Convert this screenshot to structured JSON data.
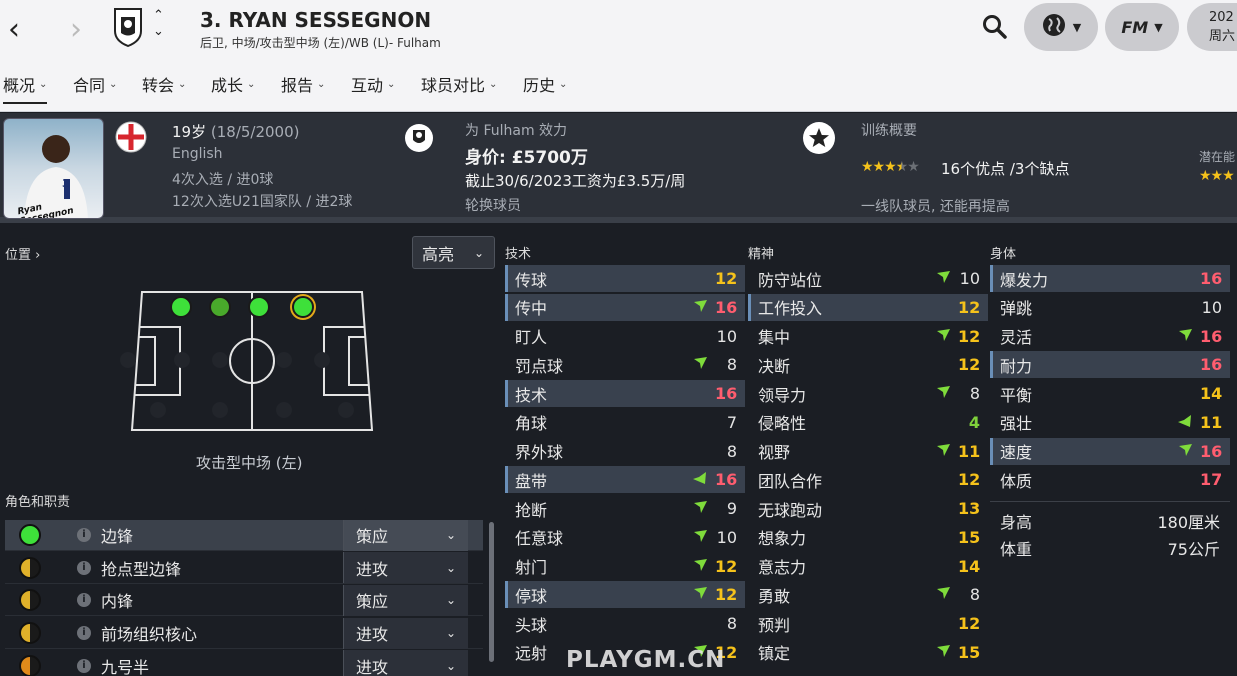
{
  "header": {
    "title": "3. RYAN SESSEGNON",
    "subtitle": "后卫, 中场/攻击型中场 (左)/WB (L)- Fulham",
    "year_fragment": "202",
    "day_fragment": "周六"
  },
  "nav_tabs": [
    "概况",
    "合同",
    "转会",
    "成长",
    "报告",
    "互动",
    "球员对比",
    "历史"
  ],
  "info": {
    "age": "19岁",
    "dob": "(18/5/2000)",
    "nationality": "English",
    "caps": "4次入选 / 进0球",
    "u21_caps": "12次入选U21国家队 / 进2球",
    "plays_for": "为 Fulham 效力",
    "value": "身价: £5700万",
    "wage": "截止30/6/2023工资为£3.5万/周",
    "squad_status": "轮换球员",
    "training_title": "训练概要",
    "training_summary": "16个优点 /3个缺点",
    "training_stars": 3.5,
    "training_note": "一线队球员, 还能再提高",
    "potential_fragment": "潜在能",
    "photo_caption": "Ryan Sessegnon",
    "shirt_number": "3"
  },
  "position": {
    "label": "位置 ›",
    "highlight_select": "高亮",
    "position_name": "攻击型中场 (左)"
  },
  "roles": {
    "title": "角色和职责",
    "items": [
      {
        "name": "边锋",
        "duty": "策应",
        "rating": "green"
      },
      {
        "name": "抢点型边锋",
        "duty": "进攻",
        "rating": "half"
      },
      {
        "name": "内锋",
        "duty": "策应",
        "rating": "half"
      },
      {
        "name": "前场组织核心",
        "duty": "进攻",
        "rating": "half"
      },
      {
        "name": "九号半",
        "duty": "进攻",
        "rating": "half-orange"
      }
    ]
  },
  "technical": {
    "title": "技术",
    "rows": [
      {
        "label": "传球",
        "value": "12",
        "color": "y",
        "arrow": "",
        "hl": true
      },
      {
        "label": "传中",
        "value": "16",
        "color": "r",
        "arrow": "up",
        "hl": true
      },
      {
        "label": "盯人",
        "value": "10",
        "color": "w",
        "arrow": "",
        "hl": false
      },
      {
        "label": "罚点球",
        "value": "8",
        "color": "w",
        "arrow": "up",
        "hl": false
      },
      {
        "label": "技术",
        "value": "16",
        "color": "r",
        "arrow": "",
        "hl": true
      },
      {
        "label": "角球",
        "value": "7",
        "color": "w",
        "arrow": "",
        "hl": false
      },
      {
        "label": "界外球",
        "value": "8",
        "color": "w",
        "arrow": "",
        "hl": false
      },
      {
        "label": "盘带",
        "value": "16",
        "color": "r",
        "arrow": "down",
        "hl": true
      },
      {
        "label": "抢断",
        "value": "9",
        "color": "w",
        "arrow": "up",
        "hl": false
      },
      {
        "label": "任意球",
        "value": "10",
        "color": "w",
        "arrow": "up",
        "hl": false
      },
      {
        "label": "射门",
        "value": "12",
        "color": "y",
        "arrow": "up",
        "hl": false
      },
      {
        "label": "停球",
        "value": "12",
        "color": "y",
        "arrow": "up",
        "hl": true
      },
      {
        "label": "头球",
        "value": "8",
        "color": "w",
        "arrow": "",
        "hl": false
      },
      {
        "label": "远射",
        "value": "12",
        "color": "y",
        "arrow": "up",
        "hl": false
      }
    ]
  },
  "mental": {
    "title": "精神",
    "rows": [
      {
        "label": "防守站位",
        "value": "10",
        "color": "w",
        "arrow": "up",
        "hl": false
      },
      {
        "label": "工作投入",
        "value": "12",
        "color": "y",
        "arrow": "",
        "hl": true
      },
      {
        "label": "集中",
        "value": "12",
        "color": "y",
        "arrow": "up",
        "hl": false
      },
      {
        "label": "决断",
        "value": "12",
        "color": "y",
        "arrow": "",
        "hl": false
      },
      {
        "label": "领导力",
        "value": "8",
        "color": "w",
        "arrow": "up",
        "hl": false
      },
      {
        "label": "侵略性",
        "value": "4",
        "color": "g",
        "arrow": "",
        "hl": false
      },
      {
        "label": "视野",
        "value": "11",
        "color": "y",
        "arrow": "up",
        "hl": false
      },
      {
        "label": "团队合作",
        "value": "12",
        "color": "y",
        "arrow": "",
        "hl": false
      },
      {
        "label": "无球跑动",
        "value": "13",
        "color": "y",
        "arrow": "",
        "hl": false
      },
      {
        "label": "想象力",
        "value": "15",
        "color": "y",
        "arrow": "",
        "hl": false
      },
      {
        "label": "意志力",
        "value": "14",
        "color": "y",
        "arrow": "",
        "hl": false
      },
      {
        "label": "勇敢",
        "value": "8",
        "color": "w",
        "arrow": "up",
        "hl": false
      },
      {
        "label": "预判",
        "value": "12",
        "color": "y",
        "arrow": "",
        "hl": false
      },
      {
        "label": "镇定",
        "value": "15",
        "color": "y",
        "arrow": "up",
        "hl": false
      }
    ]
  },
  "physical": {
    "title": "身体",
    "rows": [
      {
        "label": "爆发力",
        "value": "16",
        "color": "r",
        "arrow": "",
        "hl": true
      },
      {
        "label": "弹跳",
        "value": "10",
        "color": "w",
        "arrow": "",
        "hl": false
      },
      {
        "label": "灵活",
        "value": "16",
        "color": "r",
        "arrow": "up",
        "hl": false
      },
      {
        "label": "耐力",
        "value": "16",
        "color": "r",
        "arrow": "",
        "hl": true
      },
      {
        "label": "平衡",
        "value": "14",
        "color": "y",
        "arrow": "",
        "hl": false
      },
      {
        "label": "强壮",
        "value": "11",
        "color": "y",
        "arrow": "down",
        "hl": false
      },
      {
        "label": "速度",
        "value": "16",
        "color": "r",
        "arrow": "up",
        "hl": true
      },
      {
        "label": "体质",
        "value": "17",
        "color": "r",
        "arrow": "",
        "hl": false
      }
    ],
    "height_label": "身高",
    "height_value": "180厘米",
    "weight_label": "体重",
    "weight_value": "75公斤"
  },
  "watermark": "PLAYGM.CN",
  "colors": {
    "accent_green": "#3ee03a",
    "highlight_red": "#ff5d6f",
    "yellow": "#f5c21b"
  }
}
